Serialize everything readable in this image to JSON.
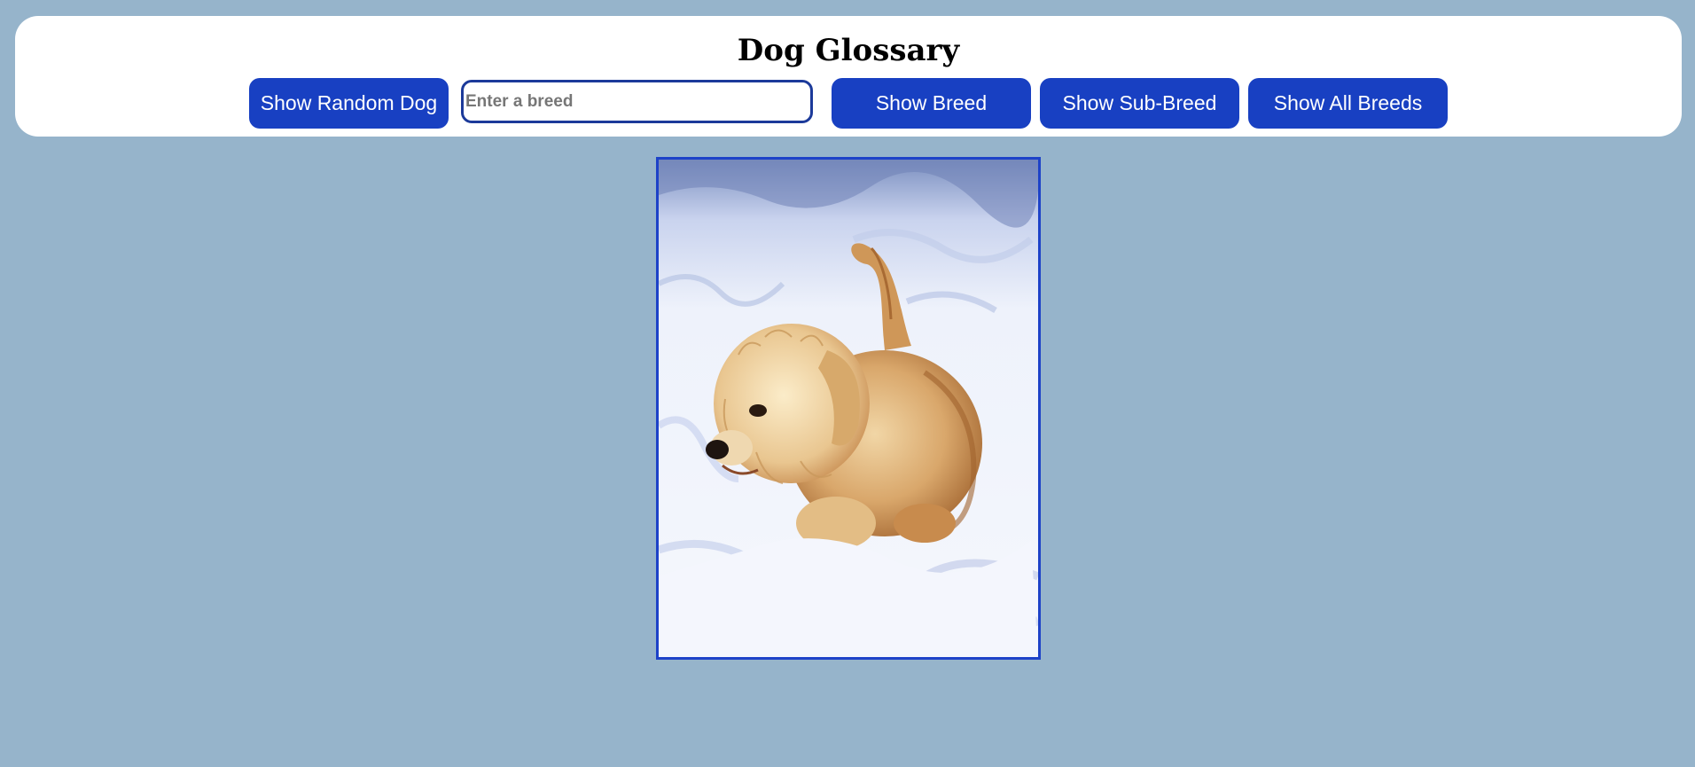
{
  "header": {
    "title": "Dog Glossary"
  },
  "controls": {
    "random_button": "Show Random Dog",
    "breed_input": {
      "placeholder": "Enter a breed",
      "value": ""
    },
    "breed_button": "Show Breed",
    "sub_breed_button": "Show Sub-Breed",
    "all_breeds_button": "Show All Breeds"
  },
  "colors": {
    "background": "#96b4cb",
    "header_bg": "#ffffff",
    "button_bg": "#1840c2",
    "button_text": "#ffffff",
    "frame_border": "#1d42c8"
  },
  "image": {
    "subject": "fluffy tan terrier walking in snow"
  }
}
